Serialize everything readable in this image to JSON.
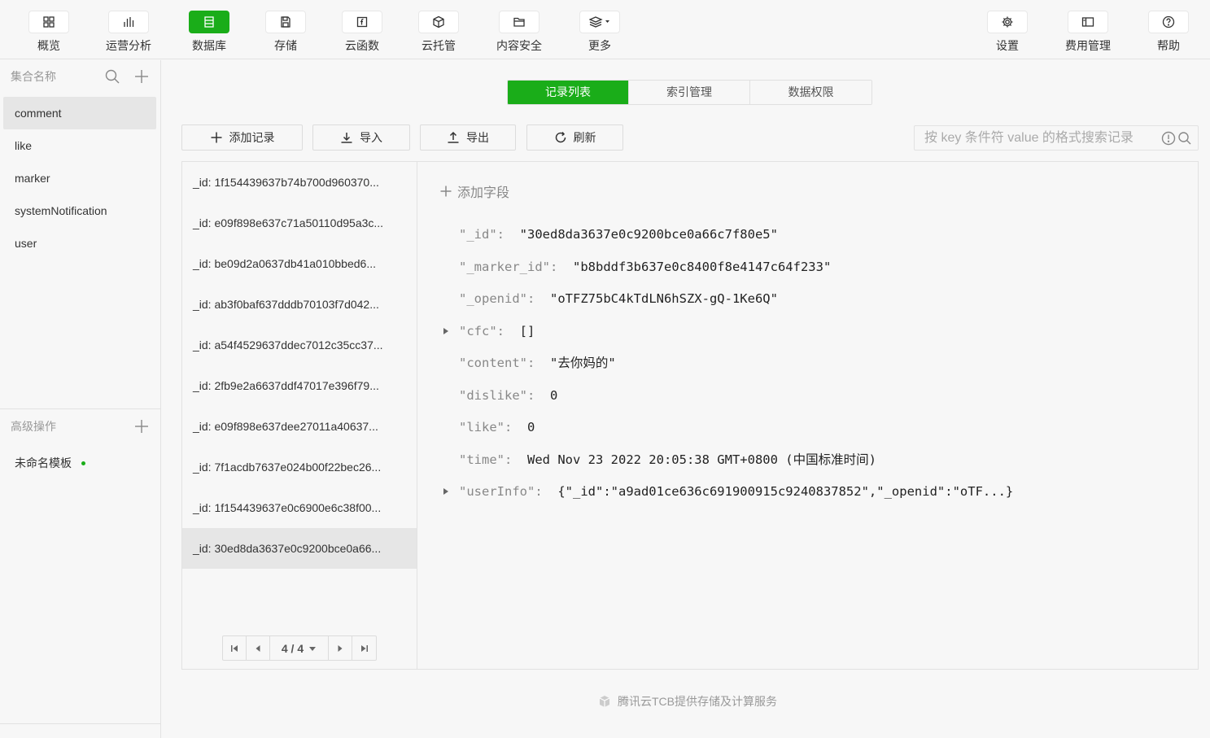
{
  "toolbar": {
    "left": [
      {
        "label": "概览",
        "icon": "grid-icon"
      },
      {
        "label": "运营分析",
        "icon": "bar-chart-icon"
      },
      {
        "label": "数据库",
        "icon": "database-icon"
      },
      {
        "label": "存储",
        "icon": "floppy-icon"
      },
      {
        "label": "云函数",
        "icon": "function-icon"
      },
      {
        "label": "云托管",
        "icon": "cube-icon"
      },
      {
        "label": "内容安全",
        "icon": "folder-icon"
      },
      {
        "label": "更多",
        "icon": "layers-icon"
      }
    ],
    "right": [
      {
        "label": "设置",
        "icon": "gear-icon"
      },
      {
        "label": "费用管理",
        "icon": "billing-icon"
      },
      {
        "label": "帮助",
        "icon": "help-icon"
      }
    ],
    "active": "数据库"
  },
  "sidebar": {
    "collections_header": "集合名称",
    "collections": [
      "comment",
      "like",
      "marker",
      "systemNotification",
      "user"
    ],
    "selected_collection": "comment",
    "advanced_header": "高级操作",
    "template_name": "未命名模板"
  },
  "tabs": [
    "记录列表",
    "索引管理",
    "数据权限"
  ],
  "active_tab": "记录列表",
  "actions": {
    "add": "添加记录",
    "import": "导入",
    "export": "导出",
    "refresh": "刷新"
  },
  "search": {
    "placeholder": "按 key 条件符 value 的格式搜索记录"
  },
  "records": [
    "_id: 1f154439637b74b700d960370...",
    "_id: e09f898e637c71a50110d95a3c...",
    "_id: be09d2a0637db41a010bbed6...",
    "_id: ab3f0baf637dddb70103f7d042...",
    "_id: a54f4529637ddec7012c35cc37...",
    "_id: 2fb9e2a6637ddf47017e396f79...",
    "_id: e09f898e637dee27011a40637...",
    "_id: 7f1acdb7637e024b00f22bec26...",
    "_id: 1f154439637e0c6900e6c38f00...",
    "_id: 30ed8da3637e0c9200bce0a66..."
  ],
  "selected_record_index": 9,
  "pager": {
    "label": "4 / 4"
  },
  "document": {
    "add_field": "添加字段",
    "fields": [
      {
        "key": "\"_id\":",
        "value": "\"30ed8da3637e0c9200bce0a66c7f80e5\"",
        "expandable": false
      },
      {
        "key": "\"_marker_id\":",
        "value": "\"b8bddf3b637e0c8400f8e4147c64f233\"",
        "expandable": false
      },
      {
        "key": "\"_openid\":",
        "value": "\"oTFZ75bC4kTdLN6hSZX-gQ-1Ke6Q\"",
        "expandable": false
      },
      {
        "key": "\"cfc\":",
        "value": "[]",
        "expandable": true
      },
      {
        "key": "\"content\":",
        "value": "\"去你妈的\"",
        "expandable": false
      },
      {
        "key": "\"dislike\":",
        "value": "0",
        "expandable": false
      },
      {
        "key": "\"like\":",
        "value": "0",
        "expandable": false
      },
      {
        "key": "\"time\":",
        "value": "Wed Nov 23 2022 20:05:38 GMT+0800 (中国标准时间)",
        "expandable": false
      },
      {
        "key": "\"userInfo\":",
        "value": "{\"_id\":\"a9ad01ce636c691900915c9240837852\",\"_openid\":\"oTF...}",
        "expandable": true
      }
    ]
  },
  "footer": "腾讯云TCB提供存储及计算服务",
  "colors": {
    "accent": "#1aad19",
    "background": "#f7f7f7"
  }
}
